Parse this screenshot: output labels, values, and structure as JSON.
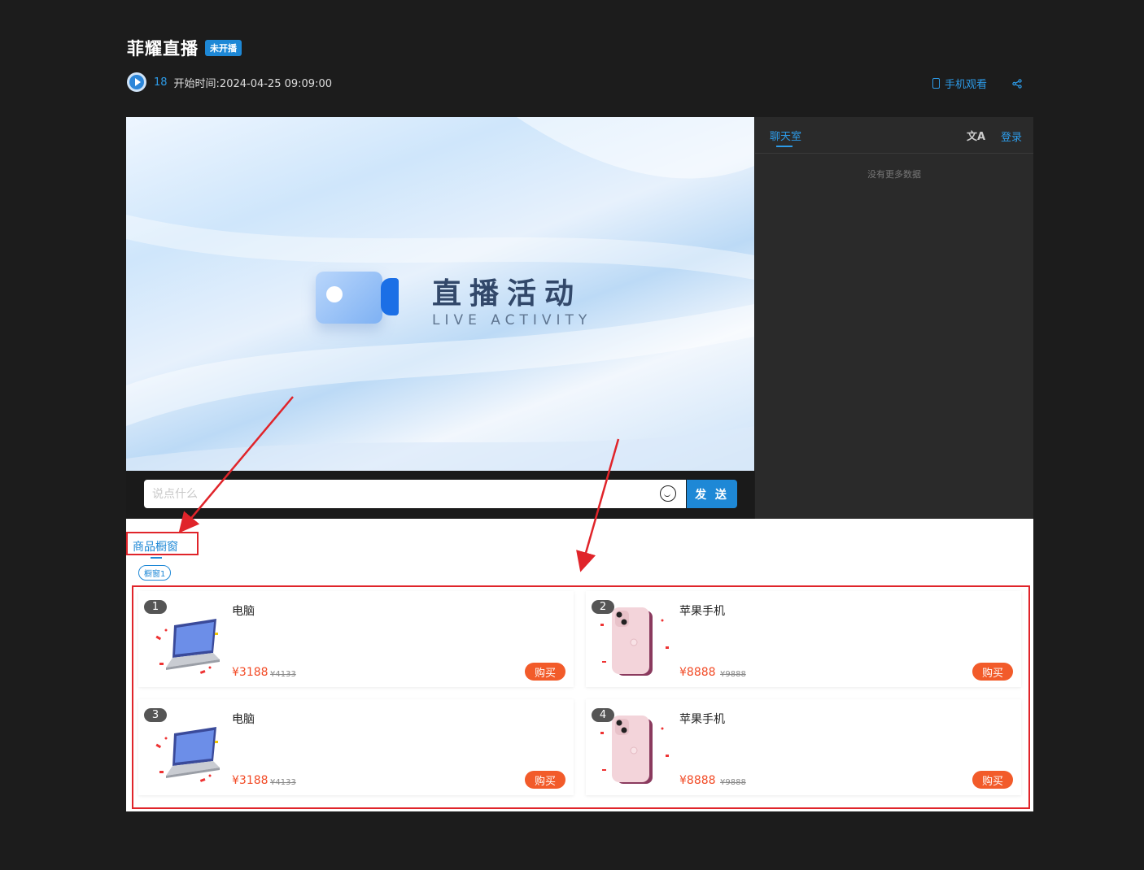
{
  "header": {
    "title": "菲耀直播",
    "status_badge": "未开播",
    "viewer_count": "18",
    "start_time": "开始时间:2024-04-25 09:09:00",
    "mobile_watch": "手机观看"
  },
  "video": {
    "title_cn": "直播活动",
    "title_en": "LIVE ACTIVITY"
  },
  "chat_input": {
    "placeholder": "说点什么",
    "send_label": "发 送"
  },
  "chat_panel": {
    "tab_label": "聊天室",
    "translate_icon": "文A",
    "login_label": "登录",
    "empty_text": "没有更多数据"
  },
  "shop": {
    "tab_label": "商品橱窗",
    "category_chip": "橱窗1",
    "products": [
      {
        "rank": "1",
        "name": "电脑",
        "price": "¥3188",
        "original_price": "¥4133",
        "buy_label": "购买",
        "image": "laptop"
      },
      {
        "rank": "2",
        "name": "苹果手机",
        "price": "¥8888",
        "original_price": "¥9888",
        "buy_label": "购买",
        "image": "phone"
      },
      {
        "rank": "3",
        "name": "电脑",
        "price": "¥3188",
        "original_price": "¥4133",
        "buy_label": "购买",
        "image": "laptop"
      },
      {
        "rank": "4",
        "name": "苹果手机",
        "price": "¥8888",
        "original_price": "¥9888",
        "buy_label": "购买",
        "image": "phone"
      }
    ]
  },
  "colors": {
    "accent": "#1e88d6",
    "price": "#f24a25",
    "buy_button": "#f25b2a",
    "annotation": "#e0242a",
    "page_bg": "#1c1c1c",
    "chat_bg": "#2a2a2a"
  }
}
